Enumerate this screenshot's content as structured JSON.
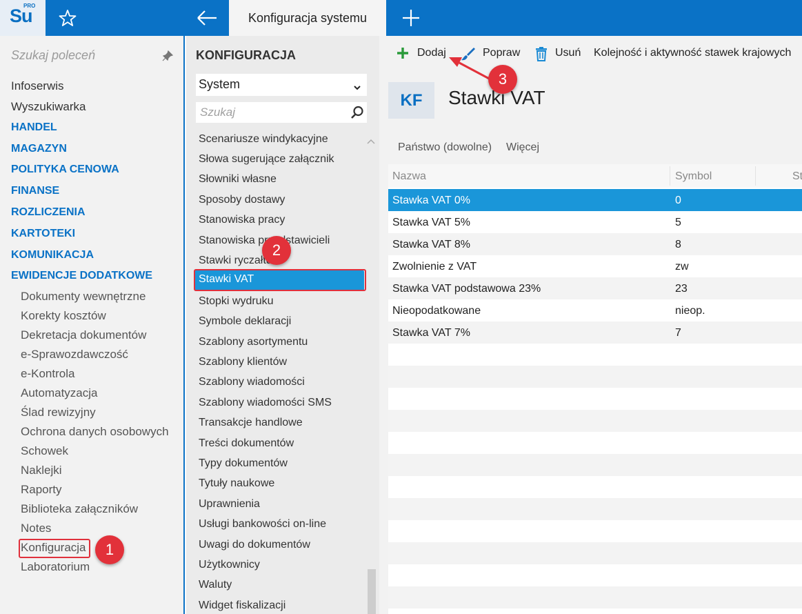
{
  "app": {
    "logo_text": "Su",
    "logo_badge": "PRO",
    "active_tab": "Konfiguracja systemu"
  },
  "command_panel": {
    "search_placeholder": "Szukaj poleceń",
    "items": [
      "Infoserwis",
      "Wyszukiwarka"
    ],
    "sections": [
      "HANDEL",
      "MAGAZYN",
      "POLITYKA CENOWA",
      "FINANSE",
      "ROZLICZENIA",
      "KARTOTEKI",
      "KOMUNIKACJA",
      "EWIDENCJE DODATKOWE"
    ],
    "sub_items": [
      "Dokumenty wewnętrzne",
      "Korekty kosztów",
      "Dekretacja dokumentów",
      "e-Sprawozdawczość",
      "e-Kontrola",
      "Automatyzacja",
      "Ślad rewizyjny",
      "Ochrona danych osobowych",
      "Schowek",
      "Naklejki",
      "Raporty",
      "Biblioteka załączników",
      "Notes",
      "Konfiguracja",
      "Laboratorium"
    ],
    "selected_sub_item": "Konfiguracja"
  },
  "config_panel": {
    "title": "KONFIGURACJA",
    "dropdown_value": "System",
    "search_placeholder": "Szukaj",
    "items": [
      "Scenariusze windykacyjne",
      "Słowa sugerujące załącznik",
      "Słowniki własne",
      "Sposoby dostawy",
      "Stanowiska pracy",
      "Stanowiska przedstawicieli",
      "Stawki ryczałtu",
      "Stawki VAT",
      "Stopki wydruku",
      "Symbole deklaracji",
      "Szablony asortymentu",
      "Szablony klientów",
      "Szablony wiadomości",
      "Szablony wiadomości SMS",
      "Transakcje handlowe",
      "Treści dokumentów",
      "Typy dokumentów",
      "Tytuły naukowe",
      "Uprawnienia",
      "Usługi bankowości on-line",
      "Uwagi do dokumentów",
      "Użytkownicy",
      "Waluty",
      "Widget fiskalizacji"
    ],
    "selected_item": "Stawki VAT"
  },
  "toolbar": {
    "add_label": "Dodaj",
    "edit_label": "Popraw",
    "delete_label": "Usuń",
    "order_label": "Kolejność i aktywność stawek krajowych"
  },
  "content": {
    "avatar": "KF",
    "title": "Stawki VAT",
    "filter_country": "Państwo (dowolne)",
    "filter_more": "Więcej"
  },
  "table": {
    "columns": [
      "Nazwa",
      "Symbol",
      "St"
    ],
    "rows": [
      [
        "Stawka VAT 0%",
        "0"
      ],
      [
        "Stawka VAT 5%",
        "5"
      ],
      [
        "Stawka VAT 8%",
        "8"
      ],
      [
        "Zwolnienie z VAT",
        "zw"
      ],
      [
        "Stawka VAT podstawowa 23%",
        "23"
      ],
      [
        "Nieopodatkowane",
        "nieop."
      ],
      [
        "Stawka VAT 7%",
        "7"
      ]
    ],
    "selected_row": 0
  },
  "callouts": [
    "1",
    "2",
    "3"
  ],
  "colors": {
    "brand_blue": "#0a72c6",
    "selection_blue": "#1a96d9",
    "section_blue": "#0a72c6",
    "callout_red": "#e2313a",
    "add_green": "#2a9a3a"
  },
  "icons": {
    "favorite": "star-icon",
    "back": "arrow-left-icon",
    "new_tab": "plus-icon",
    "pin": "pin-icon",
    "search": "search-icon",
    "dropdown": "chevron-down-icon",
    "add": "plus-icon",
    "edit": "brush-icon",
    "delete": "trash-icon"
  }
}
